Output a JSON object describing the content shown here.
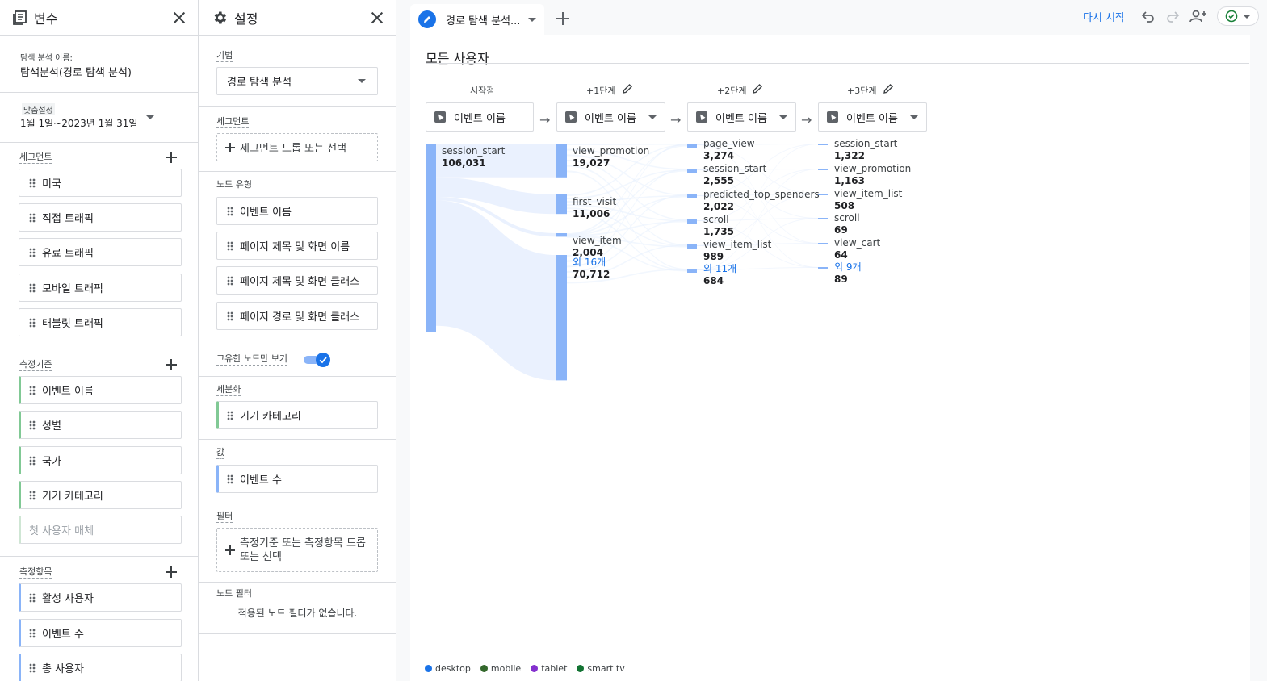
{
  "variables": {
    "title": "변수",
    "exploration_name_label": "탐색 분석 이름:",
    "exploration_name": "탐색분석(경로 탐색 분석)",
    "date_label": "맞춤설정",
    "date_range": "1월 1일~2023년 1월 31일",
    "segments_label": "세그먼트",
    "segments": [
      "미국",
      "직접 트래픽",
      "유료 트래픽",
      "모바일 트래픽",
      "태블릿 트래픽"
    ],
    "dimensions_label": "측정기준",
    "dimensions": [
      "이벤트 이름",
      "성별",
      "국가",
      "기기 카테고리"
    ],
    "dimension_placeholder": "첫 사용자 매체",
    "metrics_label": "측정항목",
    "metrics": [
      "활성 사용자",
      "이벤트 수",
      "총 사용자"
    ]
  },
  "settings": {
    "title": "설정",
    "technique_label": "기법",
    "technique_value": "경로 탐색 분석",
    "segment_label": "세그먼트",
    "segment_drop": "세그먼트 드롭 또는 선택",
    "node_type_label": "노드 유형",
    "node_types": [
      "이벤트 이름",
      "페이지 제목 및 화면 이름",
      "페이지 제목 및 화면 클래스",
      "페이지 경로 및 화면 클래스"
    ],
    "unique_nodes_label": "고유한 노드만 보기",
    "breakdown_label": "세분화",
    "breakdown_value": "기기 카테고리",
    "value_label": "값",
    "value_value": "이벤트 수",
    "filter_label": "필터",
    "filter_drop": "측정기준 또는 측정항목 드롭 또는 선택",
    "node_filter_label": "노드 필터",
    "node_filter_empty": "적용된 노드 필터가 없습니다."
  },
  "canvas": {
    "tab_label": "경로 탐색 분석...",
    "restart_label": "다시 시작",
    "segment_title": "모든 사용자",
    "steps": [
      {
        "label": "시작점",
        "select": "이벤트 이름"
      },
      {
        "label": "+1단계",
        "select": "이벤트 이름"
      },
      {
        "label": "+2단계",
        "select": "이벤트 이름"
      },
      {
        "label": "+3단계",
        "select": "이벤트 이름"
      }
    ],
    "columns": [
      [
        {
          "name": "session_start",
          "value": "106,031"
        }
      ],
      [
        {
          "name": "view_promotion",
          "value": "19,027"
        },
        {
          "name": "first_visit",
          "value": "11,006"
        },
        {
          "name": "view_item",
          "value": "2,004"
        },
        {
          "name": "외 16개",
          "value": "70,712",
          "more": true
        }
      ],
      [
        {
          "name": "page_view",
          "value": "3,274"
        },
        {
          "name": "session_start",
          "value": "2,555"
        },
        {
          "name": "predicted_top_spenders",
          "value": "2,022"
        },
        {
          "name": "scroll",
          "value": "1,735"
        },
        {
          "name": "view_item_list",
          "value": "989"
        },
        {
          "name": "외 11개",
          "value": "684",
          "more": true
        }
      ],
      [
        {
          "name": "session_start",
          "value": "1,322"
        },
        {
          "name": "view_promotion",
          "value": "1,163"
        },
        {
          "name": "view_item_list",
          "value": "508"
        },
        {
          "name": "scroll",
          "value": "69"
        },
        {
          "name": "view_cart",
          "value": "64"
        },
        {
          "name": "외 9개",
          "value": "89",
          "more": true
        }
      ]
    ],
    "legend": [
      {
        "name": "desktop",
        "color": "#1a73e8"
      },
      {
        "name": "mobile",
        "color": "#34682c"
      },
      {
        "name": "tablet",
        "color": "#8430ce"
      },
      {
        "name": "smart tv",
        "color": "#137333"
      }
    ],
    "node_color": "#8ab4f8",
    "flow_color": "#e8f0fe"
  }
}
